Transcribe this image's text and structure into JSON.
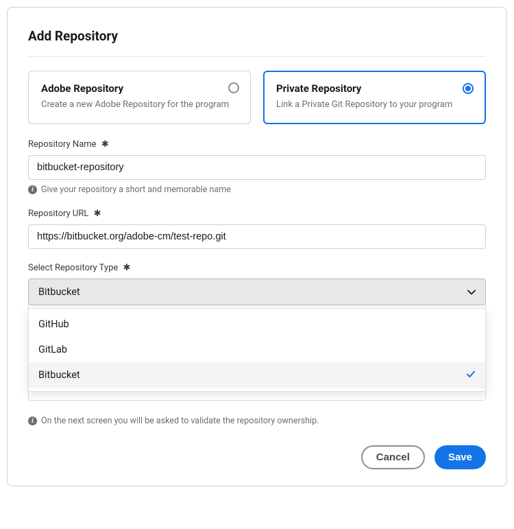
{
  "title": "Add Repository",
  "type_options": {
    "adobe": {
      "title": "Adobe Repository",
      "desc": "Create a new Adobe Repository for the program"
    },
    "private": {
      "title": "Private Repository",
      "desc": "Link a Private Git Repository to your program"
    }
  },
  "fields": {
    "repo_name": {
      "label": "Repository Name",
      "value": "bitbucket-repository",
      "hint": "Give your repository a short and memorable name"
    },
    "repo_url": {
      "label": "Repository URL",
      "value": "https://bitbucket.org/adobe-cm/test-repo.git"
    },
    "repo_type": {
      "label": "Select Repository Type",
      "selected": "Bitbucket",
      "options": [
        "GitHub",
        "GitLab",
        "Bitbucket"
      ]
    }
  },
  "asterisk": "✱",
  "footer_hint": "On the next screen you will be asked to validate the repository ownership.",
  "actions": {
    "cancel": "Cancel",
    "save": "Save"
  }
}
